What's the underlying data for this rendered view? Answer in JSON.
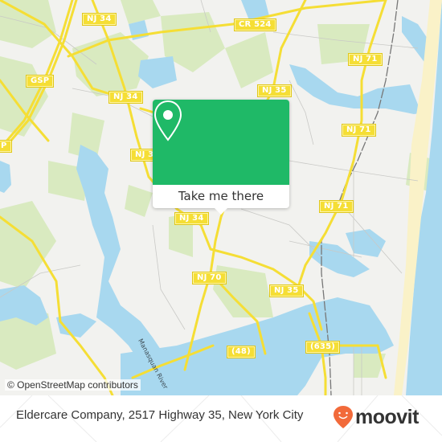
{
  "map": {
    "road_labels": [
      {
        "id": "nj34-top",
        "text": "NJ 34"
      },
      {
        "id": "cr524",
        "text": "CR 524"
      },
      {
        "id": "gsp-top",
        "text": "GSP"
      },
      {
        "id": "nj34-mid",
        "text": "NJ 34"
      },
      {
        "id": "nj35-top",
        "text": "NJ 35"
      },
      {
        "id": "nj71-top",
        "text": "NJ 71"
      },
      {
        "id": "gsp-left",
        "text": "P"
      },
      {
        "id": "nj3-left",
        "text": "NJ 3"
      },
      {
        "id": "nj71-mid",
        "text": "NJ 71"
      },
      {
        "id": "nj34-low",
        "text": "NJ 34"
      },
      {
        "id": "nj71-low",
        "text": "NJ 71"
      },
      {
        "id": "nj70",
        "text": "NJ 70"
      },
      {
        "id": "nj35-low",
        "text": "NJ 35"
      },
      {
        "id": "cr48",
        "text": "(48)"
      },
      {
        "id": "cr635",
        "text": "(635)"
      }
    ],
    "river_label": "Manasquan River",
    "attribution": "© OpenStreetMap contributors",
    "colors": {
      "water": "#a8d8ef",
      "land": "#f2f2ef",
      "park": "#d5e8b8",
      "road": "#f5de35",
      "beach": "#faf2c8"
    }
  },
  "popup": {
    "icon": "location-pin-icon",
    "button_label": "Take me there",
    "color": "#1fb967"
  },
  "footer": {
    "address": "Eldercare Company, 2517 Highway 35, New York City",
    "brand": "moovit",
    "brand_color": "#f26a3a"
  }
}
